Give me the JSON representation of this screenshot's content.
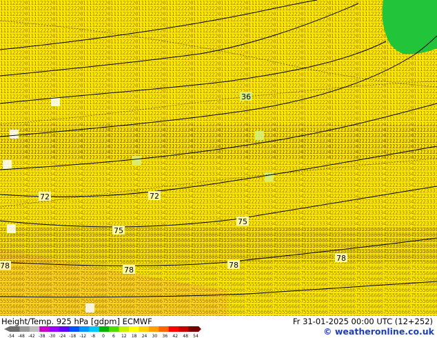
{
  "header": {
    "product": "Height/Temp. 925 hPa [gdpm] ECMWF",
    "valid_time": "Fr 31-01-2025 00:00 UTC (12+252)",
    "credit": "© weatheronline.co.uk"
  },
  "legend": {
    "ticks": [
      "-54",
      "-48",
      "-42",
      "-38",
      "-30",
      "-24",
      "-18",
      "-12",
      "-8",
      "0",
      "6",
      "12",
      "18",
      "24",
      "30",
      "36",
      "42",
      "48",
      "54"
    ],
    "colors": [
      "#6e6e6e",
      "#9a9a9a",
      "#bdbdbd",
      "#c800c8",
      "#9600ff",
      "#5a00ff",
      "#0050ff",
      "#0096ff",
      "#00c8ff",
      "#00b400",
      "#50dc00",
      "#c8f000",
      "#ffff00",
      "#ffd000",
      "#ffa000",
      "#ff6400",
      "#ff0000",
      "#c80000",
      "#780000"
    ]
  },
  "map": {
    "colors": {
      "fill_main": "#ffe800",
      "fill_warm": "#ffd21e",
      "fill_cold": "#22c43a",
      "isotherm_digits": "#7a5a00",
      "contour": "#000000"
    },
    "height_labels": [
      {
        "value": "72",
        "name": "height-label-72-west"
      },
      {
        "value": "72",
        "name": "height-label-72-center"
      },
      {
        "value": "75",
        "name": "height-label-75-center"
      },
      {
        "value": "75",
        "name": "height-label-75-east"
      },
      {
        "value": "78",
        "name": "height-label-78-west"
      },
      {
        "value": "78",
        "name": "height-label-78-center"
      },
      {
        "value": "78",
        "name": "height-label-78-east"
      },
      {
        "value": "78",
        "name": "height-label-78-southeast"
      }
    ],
    "temp_labels": [
      {
        "value": "36",
        "name": "temp-label-36"
      }
    ]
  }
}
